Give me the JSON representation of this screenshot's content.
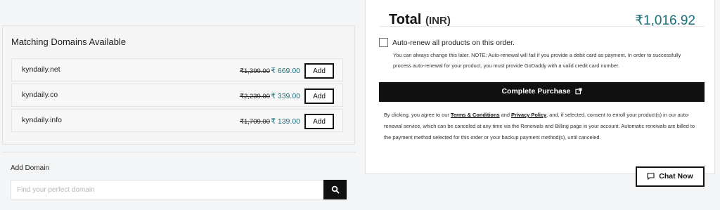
{
  "matching": {
    "title": "Matching Domains Available",
    "domains": [
      {
        "name": "kyndaily.net",
        "old_price": "₹1,399.00",
        "price": "₹ 669.00",
        "action": "Add"
      },
      {
        "name": "kyndaily.co",
        "old_price": "₹2,239.00",
        "price": "₹ 339.00",
        "action": "Add"
      },
      {
        "name": "kyndaily.info",
        "old_price": "₹1,709.00",
        "price": "₹ 139.00",
        "action": "Add"
      }
    ]
  },
  "add_domain": {
    "label": "Add Domain",
    "placeholder": "Find your perfect domain",
    "value": "",
    "search_icon": "search-icon"
  },
  "summary": {
    "total_label": "Total",
    "total_unit": "(INR)",
    "total_amount": "₹1,016.92",
    "auto_renew": {
      "checked": false,
      "label": "Auto-renew all products on this order.",
      "note": "You can always change this later. NOTE: Auto-renewal will fail if you provide a debit card as payment. In order to successfully process auto-renewal for your product, you must provide GoDaddy with a valid credit card number."
    },
    "complete_label": "Complete Purchase",
    "complete_icon": "external-link-icon",
    "legal": {
      "prefix": "By clicking, you agree to our ",
      "terms_link": "Terms & Conditions",
      "and": " and ",
      "privacy_link": "Privacy Policy",
      "suffix": ", and, if selected, consent to enroll your product(s) in our auto-renewal service, which can be canceled at any time via the Renewals and Billing page in your account. Automatic renewals are billed to the payment method selected for this order or your backup payment method(s), until canceled."
    }
  },
  "chat": {
    "label": "Chat Now",
    "icon": "chat-icon"
  },
  "colors": {
    "accent_teal": "#1a6e7a",
    "button_black": "#111111",
    "page_bg": "#f4f5f6"
  }
}
